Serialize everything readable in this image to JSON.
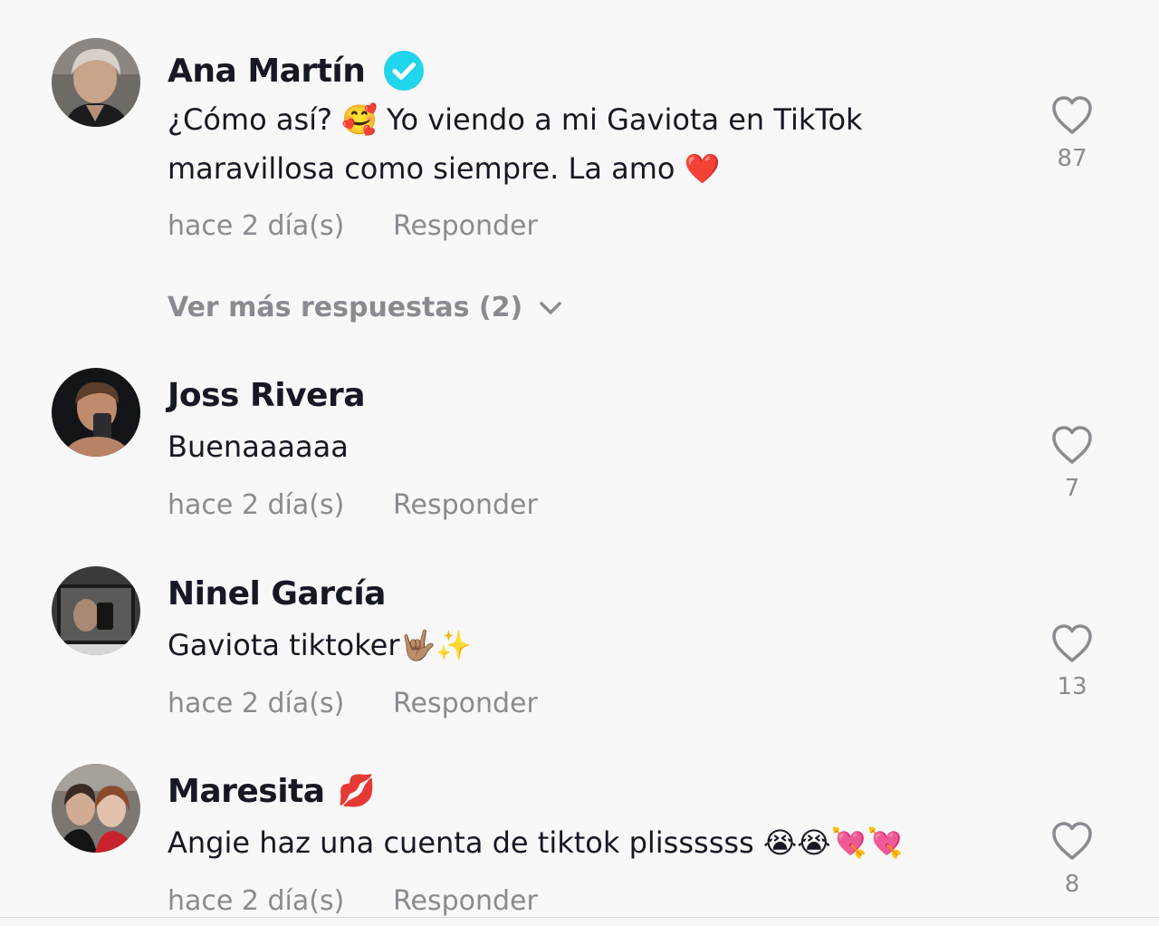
{
  "comments": [
    {
      "username": "Ana Martín",
      "verified": true,
      "verified_color": "#20d5ec",
      "text": "¿Cómo así? 🥰 Yo viendo a mi Gaviota en TikTok maravillosa como siempre. La amo ❤️",
      "time": "hace 2 día(s)",
      "reply_label": "Responder",
      "likes": "87",
      "more_replies": "Ver más respuestas (2)"
    },
    {
      "username": "Joss Rivera",
      "text": "Buenaaaaaa",
      "time": "hace 2 día(s)",
      "reply_label": "Responder",
      "likes": "7"
    },
    {
      "username": "Ninel García",
      "text": "Gaviota tiktoker🤟🏽✨",
      "time": "hace 2 día(s)",
      "reply_label": "Responder",
      "likes": "13"
    },
    {
      "username": "Maresita",
      "username_emoji": "💋",
      "text": "Angie haz una cuenta de tiktok plissssss 😭😭💘💘",
      "time": "hace 2 día(s)",
      "reply_label": "Responder",
      "likes": "8"
    }
  ],
  "colors": {
    "background": "#f8f8f8",
    "primary_text": "#161823",
    "secondary_text": "#8a8b91"
  },
  "icons": {
    "like": "heart-outline-icon",
    "verified": "verified-check-icon",
    "expand": "chevron-down-icon"
  }
}
